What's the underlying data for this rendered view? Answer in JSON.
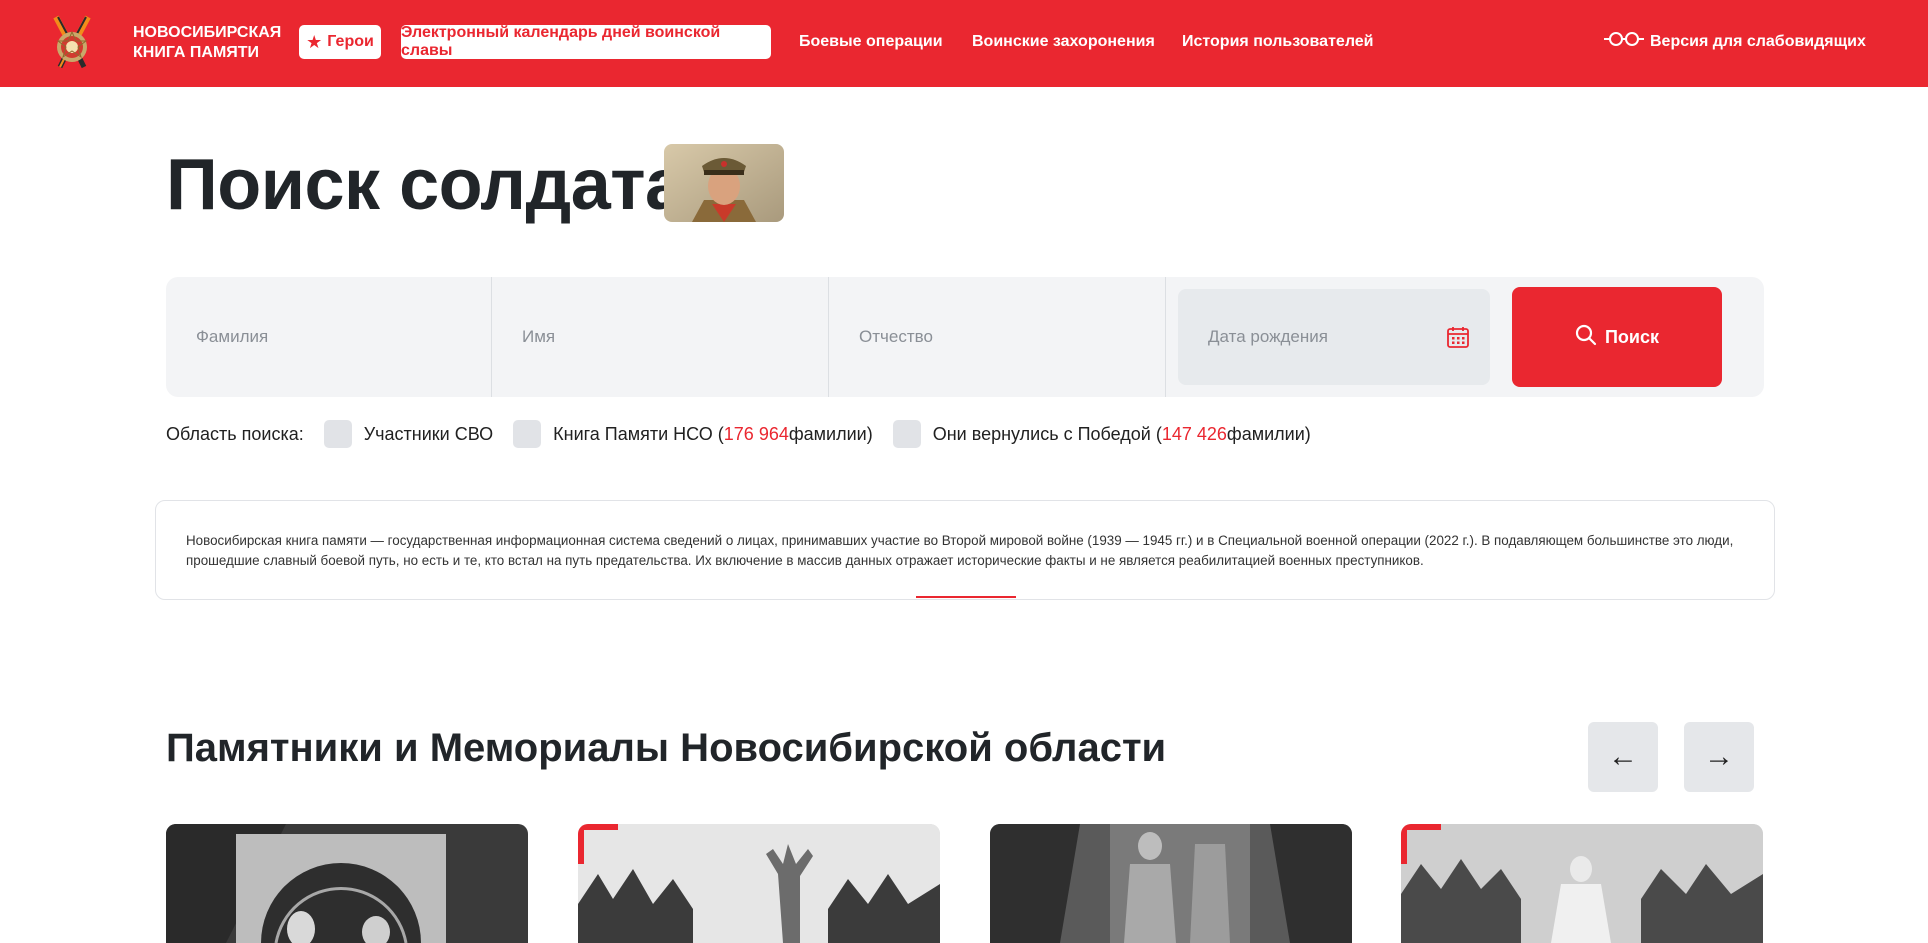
{
  "header": {
    "logo_line1": "НОВОСИБИРСКАЯ",
    "logo_line2": "КНИГА ПАМЯТИ",
    "heroes_label": "Герои",
    "calendar_label": "Электронный календарь дней воинской славы",
    "nav": [
      "Боевые операции",
      "Воинские захоронения",
      "История пользователей"
    ],
    "vision_label": "Версия для слабовидящих",
    "brand_color": "#ea2730"
  },
  "title": "Поиск солдата",
  "search": {
    "surname_placeholder": "Фамилия",
    "name_placeholder": "Имя",
    "patronymic_placeholder": "Отчество",
    "birthdate_placeholder": "Дата рождения",
    "button_label": "Поиск"
  },
  "scope": {
    "label": "Область поиска:",
    "items": [
      {
        "text": "Участники СВО"
      },
      {
        "prefix": "Книга Памяти НСО (",
        "count": "176 964",
        "suffix": " фамилии)"
      },
      {
        "prefix": "Они вернулись с Победой (",
        "count": "147 426",
        "suffix": " фамилии)"
      }
    ]
  },
  "info": {
    "text": "Новосибирская книга памяти — государственная информационная система сведений о лицах, принимавших участие во Второй мировой войне (1939 — 1945 гг.) и в Специальной военной операции (2022 г.). В подавляющем большинстве это люди, прошедшие славный боевой путь, но есть и те, кто встал на путь предательства. Их включение в массив данных отражает исторические факты и не является реабилитацией военных преступников."
  },
  "memorials": {
    "title": "Памятники и Мемориалы Новосибирской области",
    "prev_arrow": "←",
    "next_arrow": "→"
  }
}
